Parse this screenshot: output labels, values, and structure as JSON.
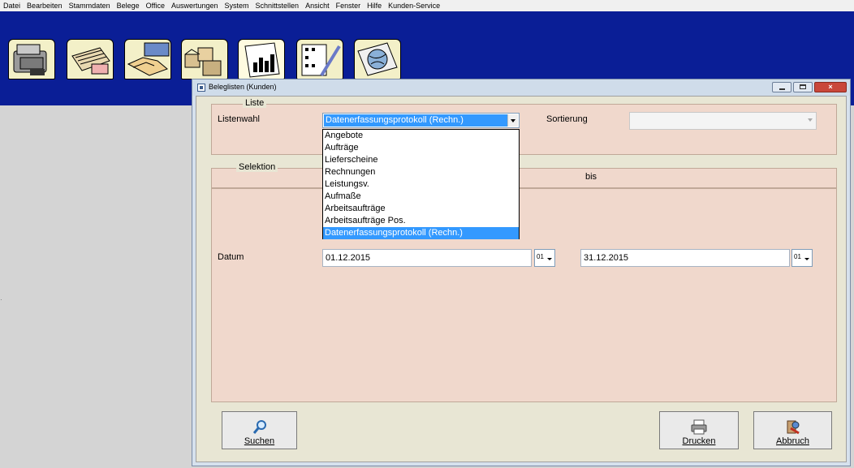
{
  "menu": [
    "Datei",
    "Bearbeiten",
    "Stammdaten",
    "Belege",
    "Office",
    "Auswertungen",
    "System",
    "Schnittstellen",
    "Ansicht",
    "Fenster",
    "Hilfe",
    "Kunden-Service"
  ],
  "toolbar": {
    "icons": [
      "cash-register-icon",
      "files-icon",
      "handshake-icon",
      "boxes-icon",
      "report-chart-icon",
      "checklist-icon",
      "globe-icon"
    ]
  },
  "window": {
    "title": "Beleglisten (Kunden)",
    "close": "×"
  },
  "liste": {
    "legend": "Liste",
    "listenwahl_label": "Listenwahl",
    "listenwahl_value": "Datenerfassungsprotokoll (Rechn.)",
    "sortierung_label": "Sortierung",
    "options": [
      "Angebote",
      "Aufträge",
      "Lieferscheine",
      "Rechnungen",
      "Leistungsv.",
      "Aufmaße",
      "Arbeitsaufträge",
      "Arbeitsaufträge Pos.",
      "Datenerfassungsprotokoll (Rechn.)"
    ],
    "selected_index": 8
  },
  "selektion": {
    "legend": "Selektion",
    "bis_label": "bis",
    "datum_label": "Datum",
    "von_value": "01.12.2015",
    "von_spin": "01",
    "bis_value": "31.12.2015",
    "bis_spin": "01"
  },
  "buttons": {
    "suchen": "Suchen",
    "drucken": "Drucken",
    "abbruch": "Abbruch"
  },
  "colors": {
    "toolbar_bg": "#0a1e96",
    "group_bg": "#f0d8cc",
    "selection": "#3399ff"
  }
}
